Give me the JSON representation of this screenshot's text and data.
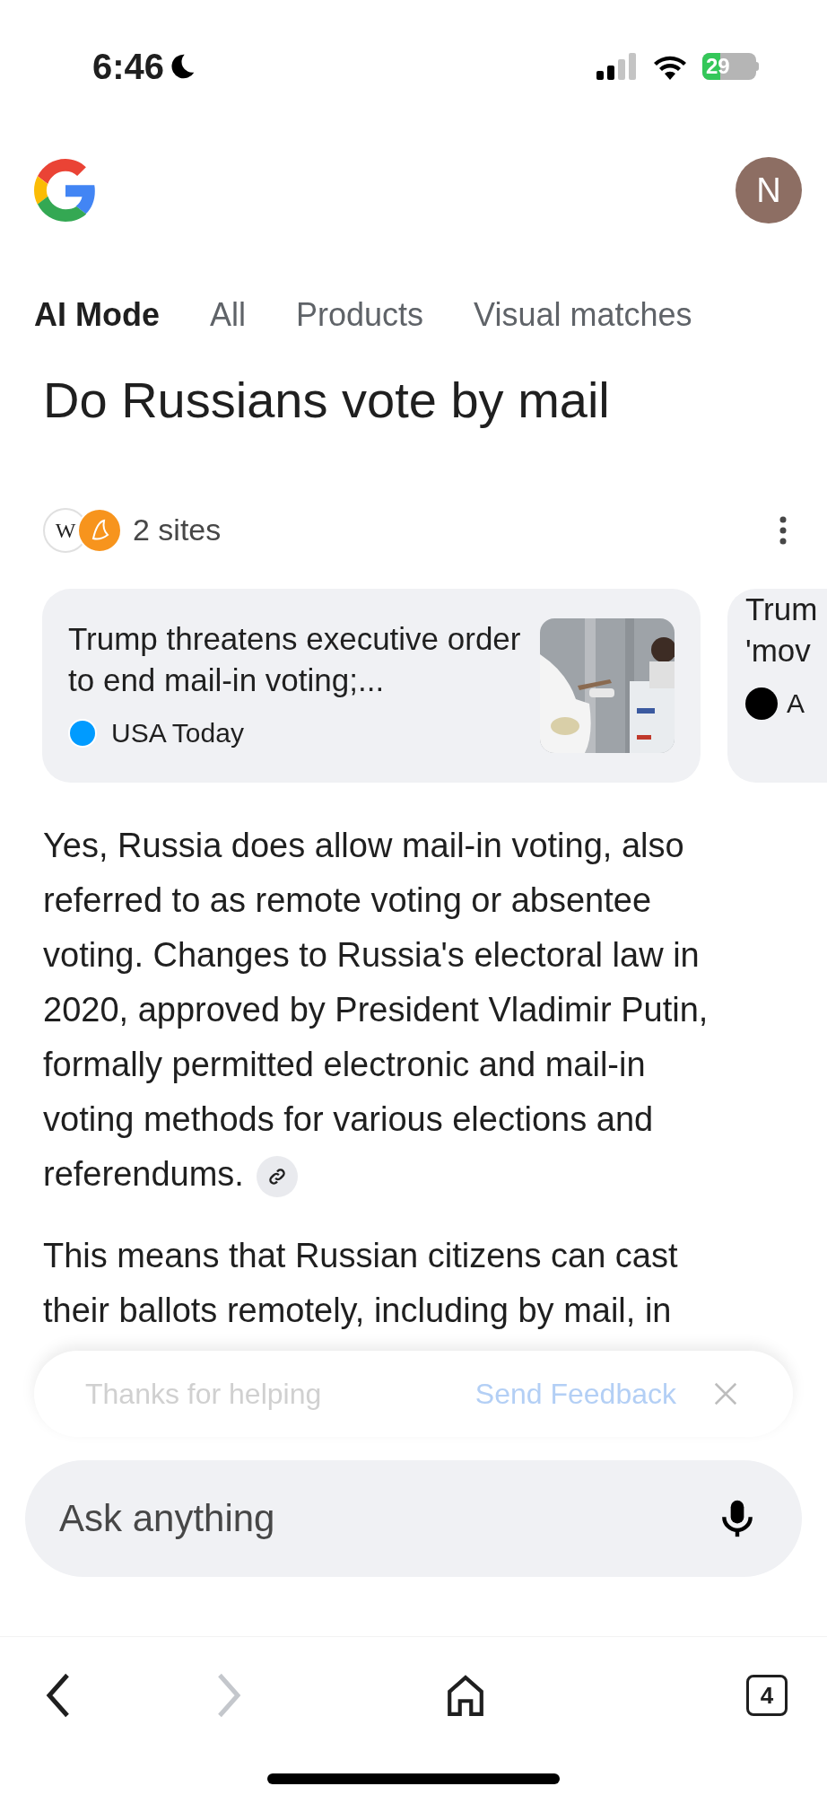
{
  "status_bar": {
    "time": "6:46",
    "battery": "29"
  },
  "avatar": {
    "initial": "N"
  },
  "tabs": [
    {
      "label": "AI Mode",
      "selected": true
    },
    {
      "label": "All",
      "selected": false
    },
    {
      "label": "Products",
      "selected": false
    },
    {
      "label": "Visual matches",
      "selected": false
    }
  ],
  "query": "Do Russians vote by mail",
  "sources": {
    "logo_letter": "W",
    "label": "2 sites"
  },
  "cards": [
    {
      "title": "Trump threatens executive order to end mail-in voting;...",
      "source": "USA Today",
      "kind": "picture"
    },
    {
      "title": "Trum 'mov",
      "source": "A",
      "kind": "text"
    }
  ],
  "answer": [
    "Yes, Russia does allow mail-in voting, also referred to as remote voting or absentee voting. Changes to Russia's electoral law in 2020, approved by President Vladimir Putin, formally permitted electronic and mail-in voting methods for various elections and referendums.",
    "This means that Russian citizens can cast their ballots remotely, including by mail, in"
  ],
  "feedback": {
    "message": "Thanks for helping",
    "action": "Send Feedback"
  },
  "ask": {
    "placeholder": "Ask anything"
  },
  "nav": {
    "tab_count": "4",
    "forward_disabled": true
  }
}
